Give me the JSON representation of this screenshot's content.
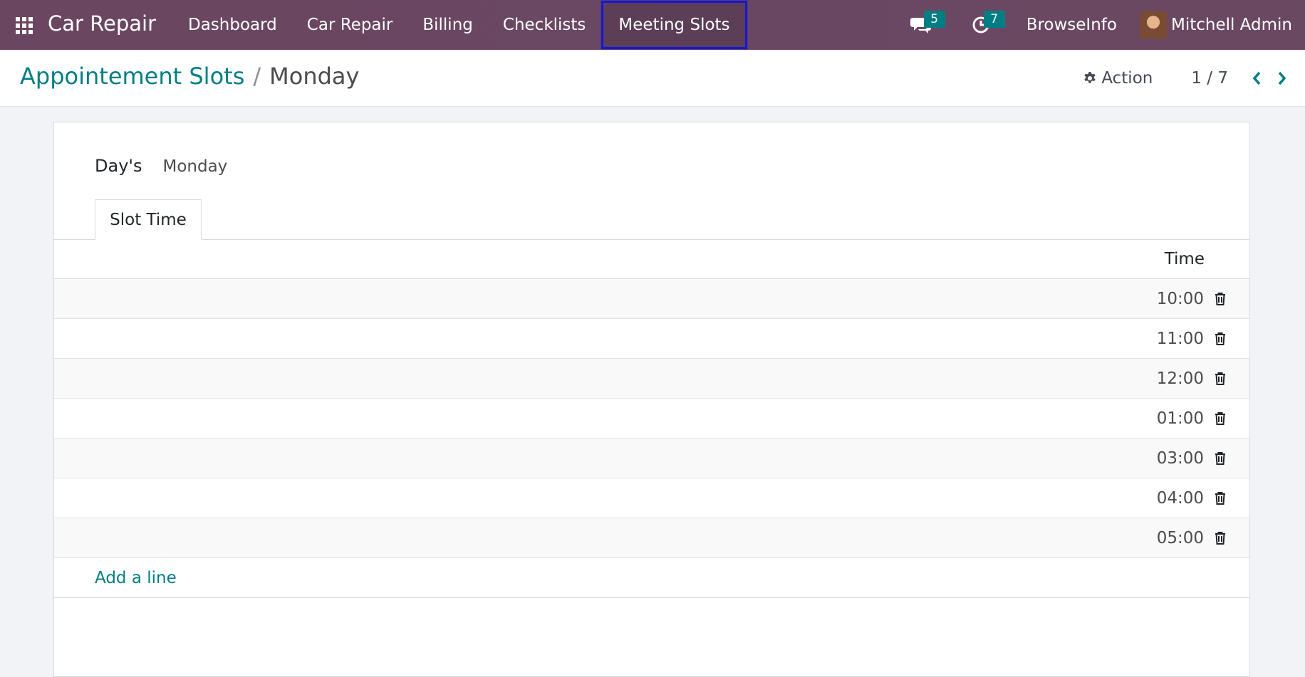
{
  "navbar": {
    "app_name": "Car Repair",
    "menu": [
      {
        "label": "Dashboard"
      },
      {
        "label": "Car Repair"
      },
      {
        "label": "Billing"
      },
      {
        "label": "Checklists"
      },
      {
        "label": "Meeting Slots"
      }
    ],
    "messages_count": "5",
    "activities_count": "7",
    "company": "BrowseInfo",
    "user": "Mitchell Admin",
    "highlight_color": "#1515e0"
  },
  "control_panel": {
    "breadcrumb_parent": "Appointement Slots",
    "breadcrumb_sep": "/",
    "breadcrumb_current": "Monday",
    "action_label": "Action",
    "pager": "1 / 7"
  },
  "form": {
    "day_label": "Day's",
    "day_value": "Monday",
    "tab_label": "Slot Time",
    "column_time": "Time",
    "rows": [
      {
        "time": "10:00"
      },
      {
        "time": "11:00"
      },
      {
        "time": "12:00"
      },
      {
        "time": "01:00"
      },
      {
        "time": "03:00"
      },
      {
        "time": "04:00"
      },
      {
        "time": "05:00"
      }
    ],
    "add_line": "Add a line"
  },
  "colors": {
    "navbar_bg": "#6b4660",
    "accent": "#017e84"
  }
}
